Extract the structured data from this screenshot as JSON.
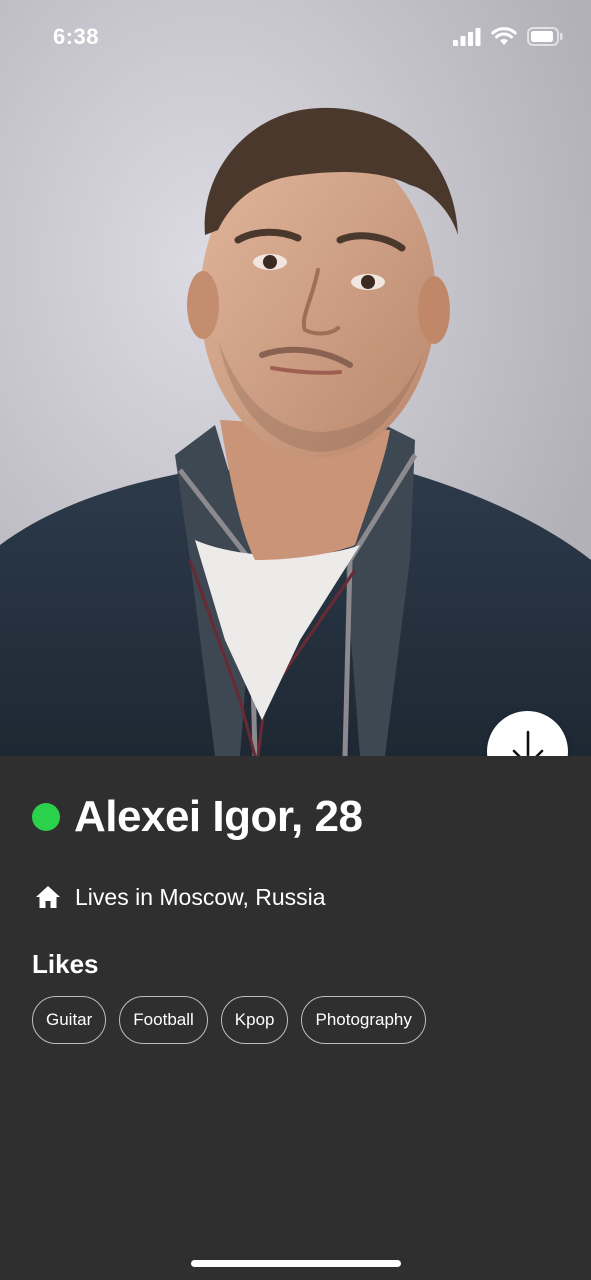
{
  "status_bar": {
    "time": "6:38"
  },
  "profile": {
    "name_age": "Alexei Igor, 28",
    "online": true,
    "online_color": "#2bd14a",
    "location": "Lives in Moscow, Russia",
    "location_icon": "home-icon"
  },
  "likes": {
    "title": "Likes",
    "items": [
      "Guitar",
      "Football",
      "Kpop",
      "Photography"
    ]
  },
  "actions": {
    "scroll_down_icon": "arrow-down-icon"
  },
  "colors": {
    "panel_background": "#2f2f2f",
    "chip_border": "#bdbdbd",
    "text": "#ffffff"
  }
}
